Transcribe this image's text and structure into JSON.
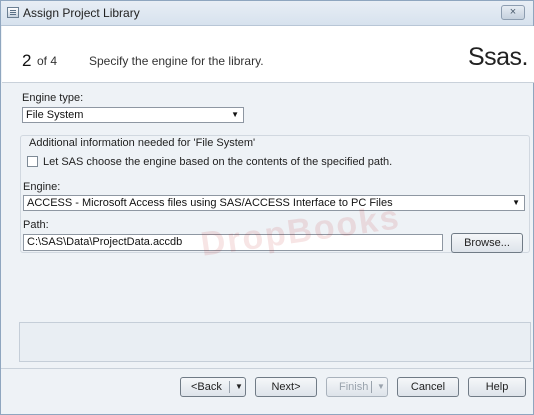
{
  "window": {
    "title": "Assign Project Library",
    "close_label": "×"
  },
  "header": {
    "step_number": "2",
    "step_of": "of 4",
    "step_description": "Specify the engine for the library.",
    "logo_text": "Ssas."
  },
  "engine_type": {
    "label": "Engine type:",
    "value": "File System"
  },
  "file_system": {
    "group_label": "Additional information needed for 'File System'",
    "auto_engine_label": "Let SAS choose the engine based on the contents of the specified path.",
    "engine_label": "Engine:",
    "engine_value": "ACCESS - Microsoft Access files using SAS/ACCESS Interface to PC Files",
    "path_label": "Path:",
    "path_value": "C:\\SAS\\Data\\ProjectData.accdb",
    "browse_label": "Browse..."
  },
  "buttons": {
    "back": "<Back",
    "next": "Next>",
    "finish": "Finish",
    "cancel": "Cancel",
    "help": "Help"
  },
  "watermark_text": "DropBooks"
}
